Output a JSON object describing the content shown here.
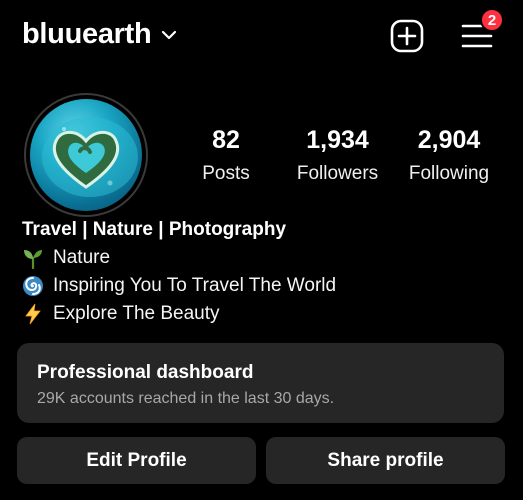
{
  "header": {
    "username": "bluuearth",
    "notification_count": "2"
  },
  "icons": {
    "dropdown": "chevron-down-icon",
    "new_post": "plus-square-icon",
    "menu": "hamburger-menu-icon"
  },
  "stats": {
    "posts": {
      "value": "82",
      "label": "Posts"
    },
    "followers": {
      "value": "1,934",
      "label": "Followers"
    },
    "following": {
      "value": "2,904",
      "label": "Following"
    }
  },
  "bio": {
    "title": "Travel | Nature | Photography",
    "lines": [
      {
        "icon": "seedling-icon",
        "text": "Nature"
      },
      {
        "icon": "cyclone-icon",
        "text": "Inspiring You To Travel The World"
      },
      {
        "icon": "lightning-icon",
        "text": "Explore The Beauty"
      }
    ]
  },
  "dashboard": {
    "title": "Professional dashboard",
    "subtitle": "29K accounts reached in the last 30 days."
  },
  "buttons": {
    "edit_profile": "Edit Profile",
    "share_profile": "Share profile"
  },
  "colors": {
    "background": "#000000",
    "card": "#262626",
    "badge": "#ff3040",
    "muted_text": "#a8a8a8"
  }
}
